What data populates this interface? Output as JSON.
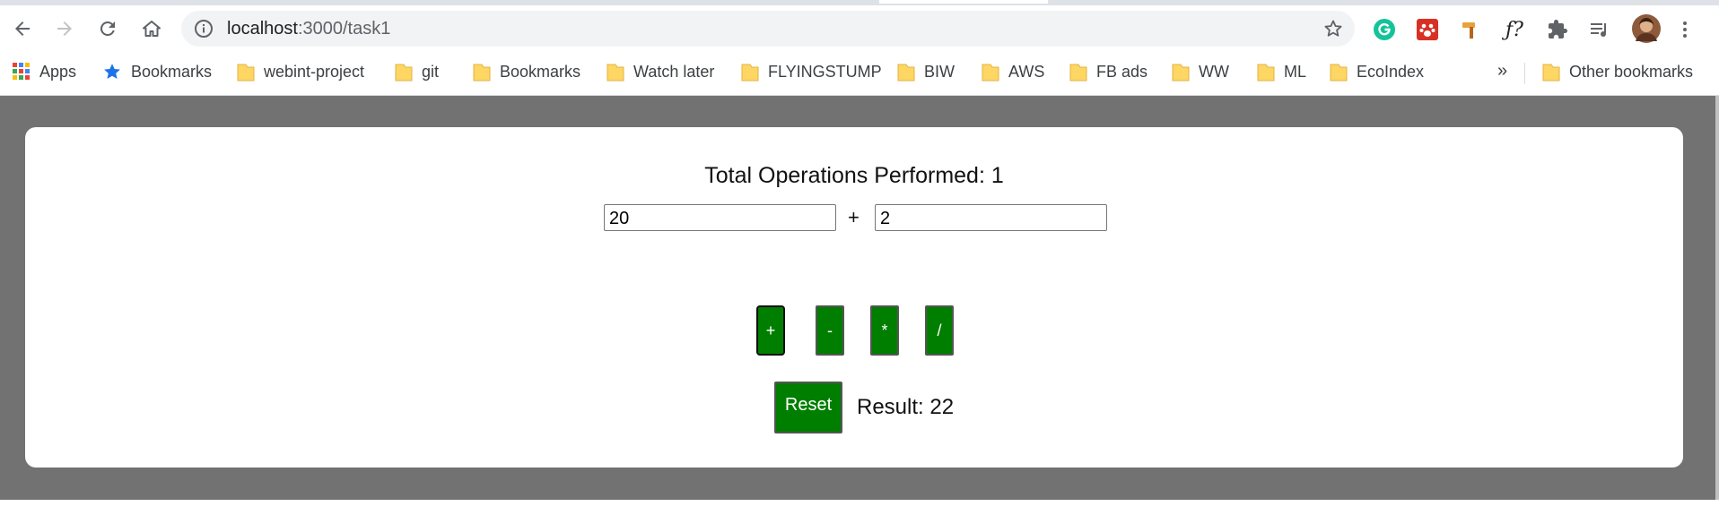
{
  "browser": {
    "url_host": "localhost",
    "url_path": ":3000/task1",
    "bookmarks": [
      {
        "label": "Apps",
        "icon": "apps-grid-icon"
      },
      {
        "label": "Bookmarks",
        "icon": "star-icon"
      },
      {
        "label": "webint-project",
        "icon": "folder-icon"
      },
      {
        "label": "git",
        "icon": "folder-icon"
      },
      {
        "label": "Bookmarks",
        "icon": "folder-icon"
      },
      {
        "label": "Watch later",
        "icon": "folder-icon"
      },
      {
        "label": "FLYINGSTUMP",
        "icon": "folder-icon"
      },
      {
        "label": "BIW",
        "icon": "folder-icon"
      },
      {
        "label": "AWS",
        "icon": "folder-icon"
      },
      {
        "label": "FB ads",
        "icon": "folder-icon"
      },
      {
        "label": "WW",
        "icon": "folder-icon"
      },
      {
        "label": "ML",
        "icon": "folder-icon"
      },
      {
        "label": "EcoIndex",
        "icon": "folder-icon"
      }
    ],
    "overflow_label": "»",
    "other_bookmarks": "Other bookmarks"
  },
  "calculator": {
    "title": "Total Operations Performed: 1",
    "operand1": "20",
    "operand2": "2",
    "current_operator": "+",
    "operators": [
      "+",
      "-",
      "*",
      "/"
    ],
    "reset_label": "Reset",
    "result_text": "Result: 22"
  },
  "colors": {
    "button_green": "#007e00",
    "page_background": "#727272",
    "folder_yellow": "#fdd663"
  }
}
